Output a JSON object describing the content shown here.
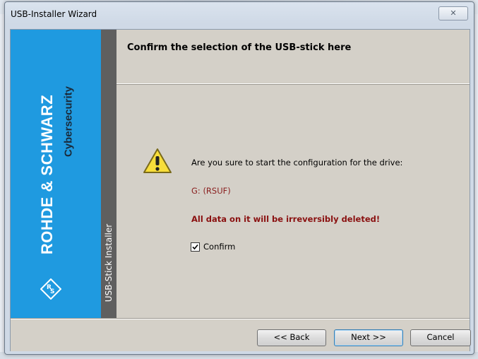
{
  "window": {
    "title": "USB-Installer Wizard",
    "close_glyph": "✕"
  },
  "branding": {
    "company": "ROHDE & SCHWARZ",
    "division": "Cybersecurity",
    "installer_label": "USB-Stick Installer",
    "blue_color": "#1f9ae0"
  },
  "header": {
    "title": "Confirm the selection of the USB-stick here"
  },
  "content": {
    "question": "Are you sure to start the configuration for the drive:",
    "drive": "G: (RSUF)",
    "warning": "All data on it will be irreversibly deleted!",
    "confirm_label": "Confirm",
    "confirm_checked": true,
    "icon": "warning-icon"
  },
  "buttons": {
    "back": "<< Back",
    "next": "Next >>",
    "cancel": "Cancel"
  }
}
